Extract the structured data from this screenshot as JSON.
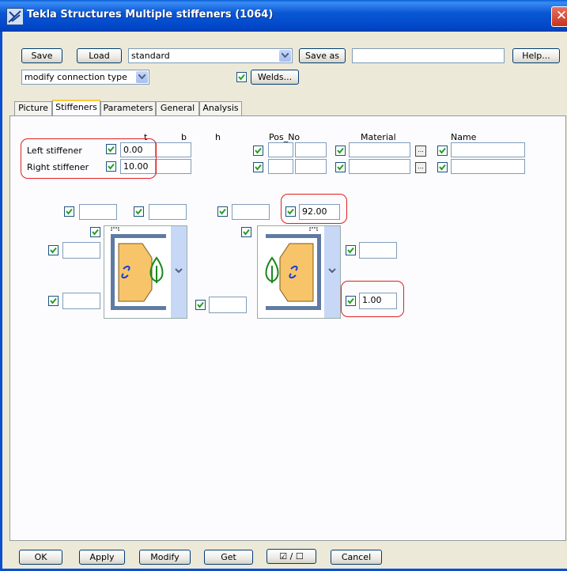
{
  "window": {
    "title": "Tekla Structures  Multiple stiffeners (1064)"
  },
  "toolbar": {
    "save_label": "Save",
    "load_label": "Load",
    "preset_value": "standard",
    "save_as_label": "Save as",
    "save_as_value": "",
    "help_label": "Help...",
    "connection_type_value": "modify connection type",
    "welds_label": "Welds..."
  },
  "tabs": [
    {
      "label": "Picture"
    },
    {
      "label": "Stiffeners"
    },
    {
      "label": "Parameters"
    },
    {
      "label": "General"
    },
    {
      "label": "Analysis"
    }
  ],
  "stiffeners": {
    "headers": {
      "t": "t",
      "b": "b",
      "h": "h",
      "pos_no": "Pos_No",
      "material": "Material",
      "name": "Name"
    },
    "rows": [
      {
        "label": "Left stiffener",
        "t": "0.00",
        "b": "",
        "pos_prefix": "",
        "pos_start": "",
        "material": "",
        "name": ""
      },
      {
        "label": "Right stiffener",
        "t": "10.00",
        "b": "",
        "pos_prefix": "",
        "pos_start": "",
        "material": "",
        "name": ""
      }
    ],
    "browse_label": "..."
  },
  "diagram": {
    "left_top_1": "",
    "left_top_2": "",
    "right_top_1": "",
    "right_top_2": "92.00",
    "left_mid": "",
    "left_bottom": "",
    "middle_bottom": "",
    "right_mid": "",
    "right_bottom": "1.00"
  },
  "footer": {
    "ok_label": "OK",
    "apply_label": "Apply",
    "modify_label": "Modify",
    "get_label": "Get",
    "toggle_label": "☑ / ☐",
    "cancel_label": "Cancel"
  },
  "colors": {
    "title_bar": "#0a58d4",
    "highlight": "#e02020",
    "plate_fill": "#f7c46a",
    "weld_symbol": "#1a8a1a",
    "rotate_icon": "#1a3fd0"
  }
}
